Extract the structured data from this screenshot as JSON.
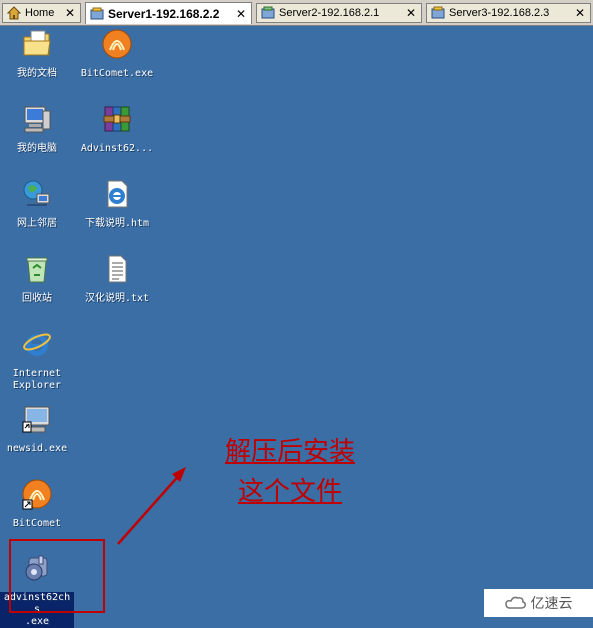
{
  "tabs": [
    {
      "label": "Home",
      "active": false,
      "icon": "home-icon"
    },
    {
      "label": "Server1-192.168.2.2",
      "active": true,
      "icon": "vm-icon"
    },
    {
      "label": "Server2-192.168.2.1",
      "active": false,
      "icon": "vm-icon"
    },
    {
      "label": "Server3-192.168.2.3",
      "active": false,
      "icon": "vm-icon"
    }
  ],
  "desktop": {
    "icons": [
      {
        "label": "我的文档",
        "icon": "my-documents-icon"
      },
      {
        "label": "我的电脑",
        "icon": "my-computer-icon"
      },
      {
        "label": "网上邻居",
        "icon": "network-places-icon"
      },
      {
        "label": "回收站",
        "icon": "recycle-bin-icon"
      },
      {
        "label": "Internet\nExplorer",
        "icon": "internet-explorer-icon"
      },
      {
        "label": "newsid.exe",
        "icon": "newsid-icon"
      },
      {
        "label": "BitComet",
        "icon": "bitcomet-icon"
      },
      {
        "label": "advinst62chs\n.exe",
        "icon": "installer-icon"
      },
      {
        "label": "BitComet.exe",
        "icon": "bitcomet-icon"
      },
      {
        "label": "Advinst62...",
        "icon": "winrar-archive-icon"
      },
      {
        "label": "下载说明.htm",
        "icon": "html-file-icon"
      },
      {
        "label": "汉化说明.txt",
        "icon": "text-file-icon"
      }
    ]
  },
  "annotation": {
    "line1": "解压后安装",
    "line2": "这个文件"
  },
  "watermark": {
    "text": "亿速云",
    "icon": "cloud-logo-icon"
  },
  "colors": {
    "desktop": "#3a6ea5",
    "annotation": "#c00000",
    "selection": "#0a246a"
  }
}
